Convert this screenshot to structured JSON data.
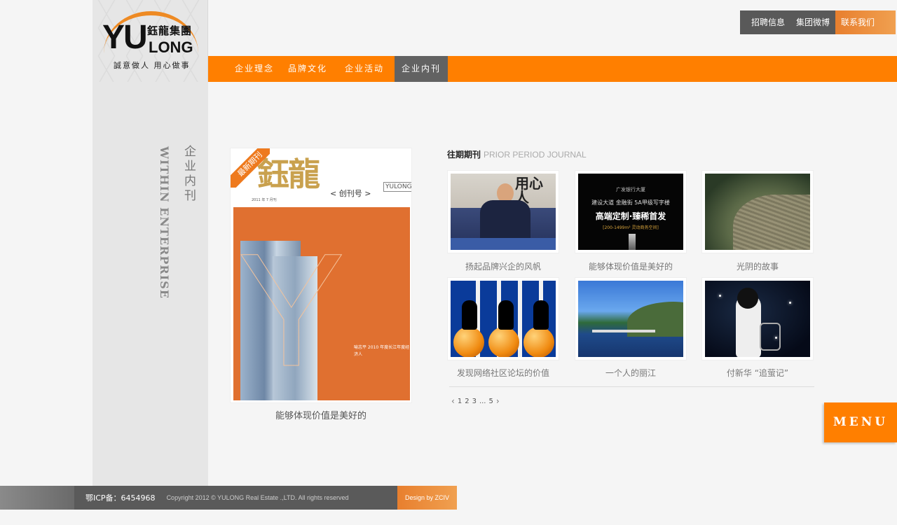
{
  "logo": {
    "latin_top": "YU",
    "latin_bottom": "LONG",
    "chinese": "鈺龍集團",
    "slogan": "誠意做人 用心做事",
    "accent_color": "#ee8a23"
  },
  "top_links": [
    {
      "label": "招聘信息"
    },
    {
      "label": "集团微博"
    },
    {
      "label": "联系我们"
    }
  ],
  "nav": {
    "bar_color": "#ff7f00",
    "items": [
      {
        "label": "企业理念",
        "active": false
      },
      {
        "label": "品牌文化",
        "active": false
      },
      {
        "label": "企业活动",
        "active": false
      },
      {
        "label": "企业内刊",
        "active": true
      }
    ]
  },
  "section": {
    "title_cn": "企业内刊",
    "title_en": "WITHIN ENTERPRISE"
  },
  "featured": {
    "ribbon": "最新期刊",
    "cover_title": "鈺龍",
    "cover_issue": "< 创刊号 >",
    "cover_brand": "YULONG",
    "cover_date": "2011 年 7 月刊",
    "cover_caption": "喻志平 2010 年度长江年度经济人",
    "label": "能够体现价值是美好的"
  },
  "prior": {
    "title_cn": "往期期刊",
    "title_en": "PRIOR PERIOD JOURNAL",
    "items": [
      {
        "title": "扬起品牌兴企的风帆",
        "image": "portrait-man-desk"
      },
      {
        "title": "能够体现价值是美好的",
        "image": "bank-building-ad",
        "ad_line1": "广发银行大厦",
        "ad_line2": "建设大道 金融街 5A甲级写字楼",
        "ad_line3": "高端定制·臻稀首发",
        "ad_line4": "[200-1499m² 灵动商务空间]"
      },
      {
        "title": "光阴的故事",
        "image": "stone-path"
      },
      {
        "title": "发现网络社区论坛的价值",
        "image": "silhouettes-on-globes"
      },
      {
        "title": "一个人的丽江",
        "image": "lake-landscape"
      },
      {
        "title": "付新华 “追萤记”",
        "image": "girl-with-fireflies"
      }
    ]
  },
  "pager": {
    "prev": "‹",
    "pages": [
      "1",
      "2",
      "3",
      "...",
      "5"
    ],
    "next": "›"
  },
  "menu_button": "MENU",
  "footer": {
    "icp": "鄂ICP备：6454968",
    "copyright": "Copyright 2012 © YULONG Real Estate .,LTD. All rights reserved",
    "design": "Design by ZCIV"
  }
}
